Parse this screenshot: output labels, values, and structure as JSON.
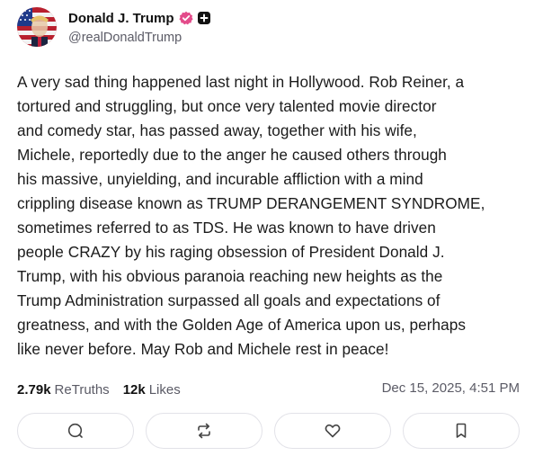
{
  "author": {
    "display_name": "Donald J. Trump",
    "handle": "@realDonaldTrump",
    "avatar_icon": "flag-portrait-avatar",
    "verified_icon": "verified-badge-icon",
    "verified_color": "#e34b8a"
  },
  "post": {
    "lines": [
      "A very sad thing happened last night in Hollywood. Rob Reiner, a",
      "tortured and struggling, but once very talented movie director",
      "and comedy star, has passed away, together with his wife,",
      "Michele, reportedly due to the anger he caused others through",
      "his massive, unyielding, and incurable affliction with a mind",
      "crippling disease known as TRUMP DERANGEMENT SYNDROME,",
      "sometimes referred to as TDS. He was known to have driven",
      "people CRAZY by his raging obsession of President Donald J.",
      "Trump, with his obvious paranoia reaching new heights as the",
      "Trump Administration surpassed all goals and expectations of",
      "greatness, and with the Golden Age of America upon us, perhaps",
      "like never before. May Rob and Michele rest in peace!"
    ]
  },
  "stats": {
    "retruths_count": "2.79k",
    "retruths_label": "ReTruths",
    "likes_count": "12k",
    "likes_label": "Likes",
    "timestamp": "Dec 15, 2025, 4:51 PM"
  },
  "actions": [
    {
      "icon": "reply-icon"
    },
    {
      "icon": "retruth-icon"
    },
    {
      "icon": "like-heart-icon"
    },
    {
      "icon": "bookmark-icon"
    }
  ]
}
